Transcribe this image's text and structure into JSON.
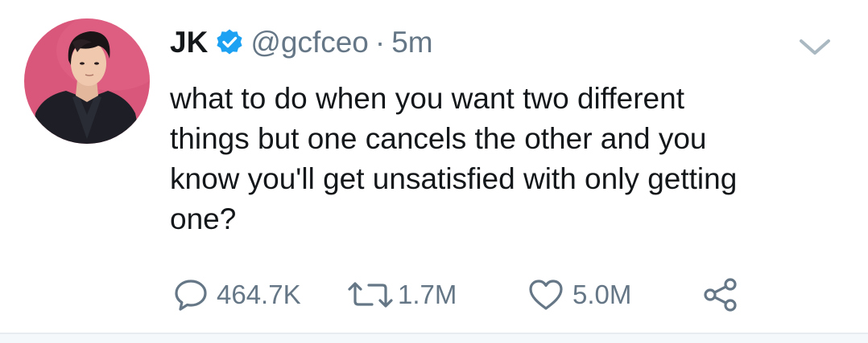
{
  "tweet": {
    "author": {
      "name": "JK",
      "handle": "@gcfceo",
      "verified": true,
      "separator": "·",
      "time": "5m"
    },
    "text_lines": [
      "what to do when you want two different",
      "things but one cancels the other and you",
      "know you'll get unsatisfied with only getting",
      "one?"
    ],
    "actions": {
      "replies": "464.7K",
      "retweets": "1.7M",
      "likes": "5.0M"
    }
  },
  "icons": {
    "verified": "verified-badge-icon",
    "menu": "chevron-down-icon",
    "reply": "reply-bubble-icon",
    "retweet": "retweet-icon",
    "like": "heart-icon",
    "share": "share-icon"
  },
  "colors": {
    "text_primary": "#14171a",
    "text_secondary": "#657786",
    "verified_blue": "#1da1f2",
    "icon_gray": "#657786",
    "chevron_gray": "#aab8c2",
    "avatar_background": "#d9577a"
  }
}
